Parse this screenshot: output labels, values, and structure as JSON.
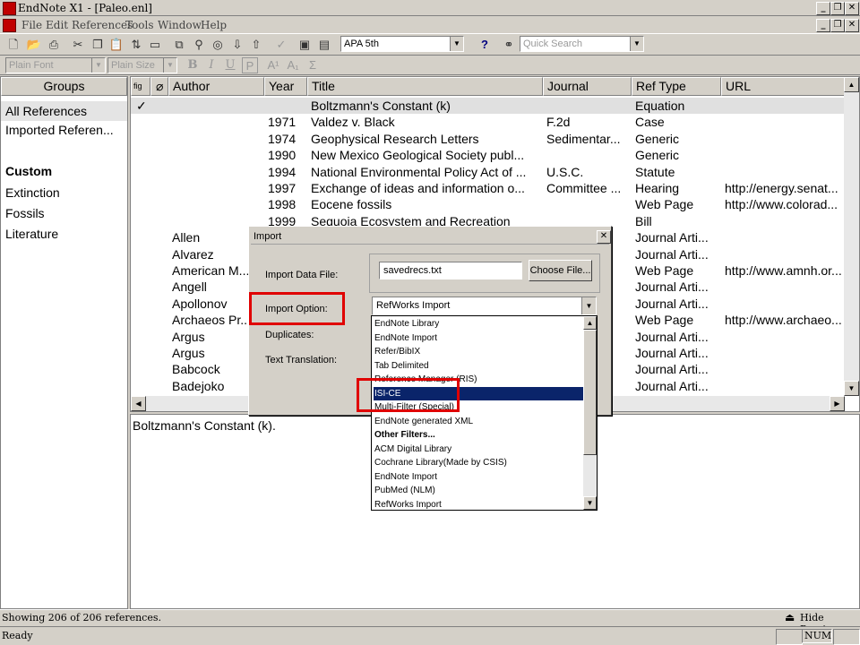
{
  "window": {
    "title": "EndNote X1 - [Paleo.enl]",
    "controls": [
      "_",
      "❐",
      "✕"
    ],
    "doc_controls": [
      "_",
      "❐",
      "✕"
    ]
  },
  "menu": [
    "File",
    "Edit",
    "References",
    "Tools",
    "Window",
    "Help"
  ],
  "toolbar": {
    "style": "APA 5th",
    "quick_search_placeholder": "Quick Search",
    "font": "Plain Font",
    "size": "Plain Size",
    "format_buttons": [
      "B",
      "I",
      "U",
      "P",
      "A¹",
      "A₁",
      "Σ"
    ]
  },
  "groups": {
    "header": "Groups",
    "items": [
      "All References",
      "Imported Referen...",
      "Custom",
      "Extinction",
      "Fossils",
      "Literature"
    ]
  },
  "reflist": {
    "columns": [
      "Author",
      "Year",
      "Title",
      "Journal",
      "Ref Type",
      "URL"
    ],
    "rows": [
      {
        "check": "✓",
        "author": "",
        "year": "",
        "title": "Boltzmann's Constant (k)",
        "journal": "",
        "type": "Equation",
        "url": ""
      },
      {
        "check": "",
        "author": "",
        "year": "1971",
        "title": "Valdez v. Black",
        "journal": "F.2d",
        "type": "Case",
        "url": ""
      },
      {
        "check": "",
        "author": "",
        "year": "1974",
        "title": "Geophysical Research Letters",
        "journal": "Sedimentar...",
        "type": "Generic",
        "url": ""
      },
      {
        "check": "",
        "author": "",
        "year": "1990",
        "title": "New Mexico Geological Society publ...",
        "journal": "",
        "type": "Generic",
        "url": ""
      },
      {
        "check": "",
        "author": "",
        "year": "1994",
        "title": "National Environmental Policy Act of ...",
        "journal": "U.S.C.",
        "type": "Statute",
        "url": ""
      },
      {
        "check": "",
        "author": "",
        "year": "1997",
        "title": "Exchange of ideas and information o...",
        "journal": "Committee ...",
        "type": "Hearing",
        "url": "http://energy.senat..."
      },
      {
        "check": "",
        "author": "",
        "year": "1998",
        "title": "Eocene fossils",
        "journal": "",
        "type": "Web Page",
        "url": "http://www.colorad..."
      },
      {
        "check": "",
        "author": "",
        "year": "1999",
        "title": "Sequoia Ecosystem and Recreation",
        "journal": "",
        "type": "Bill",
        "url": ""
      },
      {
        "check": "",
        "author": "Allen",
        "year": "",
        "title": "",
        "journal": "...",
        "type": "Journal Arti...",
        "url": ""
      },
      {
        "check": "",
        "author": "Alvarez",
        "year": "",
        "title": "",
        "journal": "",
        "type": "Journal Arti...",
        "url": ""
      },
      {
        "check": "",
        "author": "American M...",
        "year": "",
        "title": "",
        "journal": "",
        "type": "Web Page",
        "url": "http://www.amnh.or..."
      },
      {
        "check": "",
        "author": "Angell",
        "year": "",
        "title": "",
        "journal": "",
        "type": "Journal Arti...",
        "url": ""
      },
      {
        "check": "",
        "author": "Apollonov",
        "year": "",
        "title": "",
        "journal": "",
        "type": "Journal Arti...",
        "url": ""
      },
      {
        "check": "",
        "author": "Archaeos Pr...",
        "year": "",
        "title": "",
        "journal": "",
        "type": "Web Page",
        "url": "http://www.archaeo..."
      },
      {
        "check": "",
        "author": "Argus",
        "year": "",
        "title": "",
        "journal": "",
        "type": "Journal Arti...",
        "url": ""
      },
      {
        "check": "",
        "author": "Argus",
        "year": "",
        "title": "",
        "journal": "",
        "type": "Journal Arti...",
        "url": ""
      },
      {
        "check": "",
        "author": "Babcock",
        "year": "",
        "title": "",
        "journal": "",
        "type": "Journal Arti...",
        "url": ""
      },
      {
        "check": "",
        "author": "Badejoko",
        "year": "",
        "title": "",
        "journal": "",
        "type": "Journal Arti...",
        "url": ""
      }
    ]
  },
  "preview_text": "Boltzmann's Constant (k).",
  "status": {
    "count": "Showing 206 of 206 references.",
    "hide_preview": "Hide Preview",
    "ready": "Ready",
    "num": "NUM"
  },
  "import_dialog": {
    "title": "Import",
    "close": "✕",
    "data_file_label": "Import Data File:",
    "data_file_value": "savedrecs.txt",
    "choose_file": "Choose File...",
    "option_label": "Import Option:",
    "option_value": "RefWorks Import",
    "duplicates_label": "Duplicates:",
    "translation_label": "Text Translation:",
    "options": [
      {
        "label": "EndNote Library",
        "bold": false,
        "selected": false
      },
      {
        "label": "EndNote Import",
        "bold": false,
        "selected": false
      },
      {
        "label": "Refer/BibIX",
        "bold": false,
        "selected": false
      },
      {
        "label": "Tab Delimited",
        "bold": false,
        "selected": false
      },
      {
        "label": "Reference Manager (RIS)",
        "bold": false,
        "selected": false
      },
      {
        "label": "ISI-CE",
        "bold": false,
        "selected": true
      },
      {
        "label": "Multi-Filter (Special)",
        "bold": false,
        "selected": false
      },
      {
        "label": "EndNote generated XML",
        "bold": false,
        "selected": false
      },
      {
        "label": "Other Filters...",
        "bold": true,
        "selected": false
      },
      {
        "label": "ACM Digital Library",
        "bold": false,
        "selected": false
      },
      {
        "label": "Cochrane Library(Made by CSIS)",
        "bold": false,
        "selected": false
      },
      {
        "label": "EndNote Import",
        "bold": false,
        "selected": false
      },
      {
        "label": "PubMed (NLM)",
        "bold": false,
        "selected": false
      },
      {
        "label": "RefWorks Import",
        "bold": false,
        "selected": false
      }
    ]
  },
  "colors": {
    "highlight": "#0a246a",
    "annotation": "#e00000",
    "face": "#d4d0c8"
  }
}
